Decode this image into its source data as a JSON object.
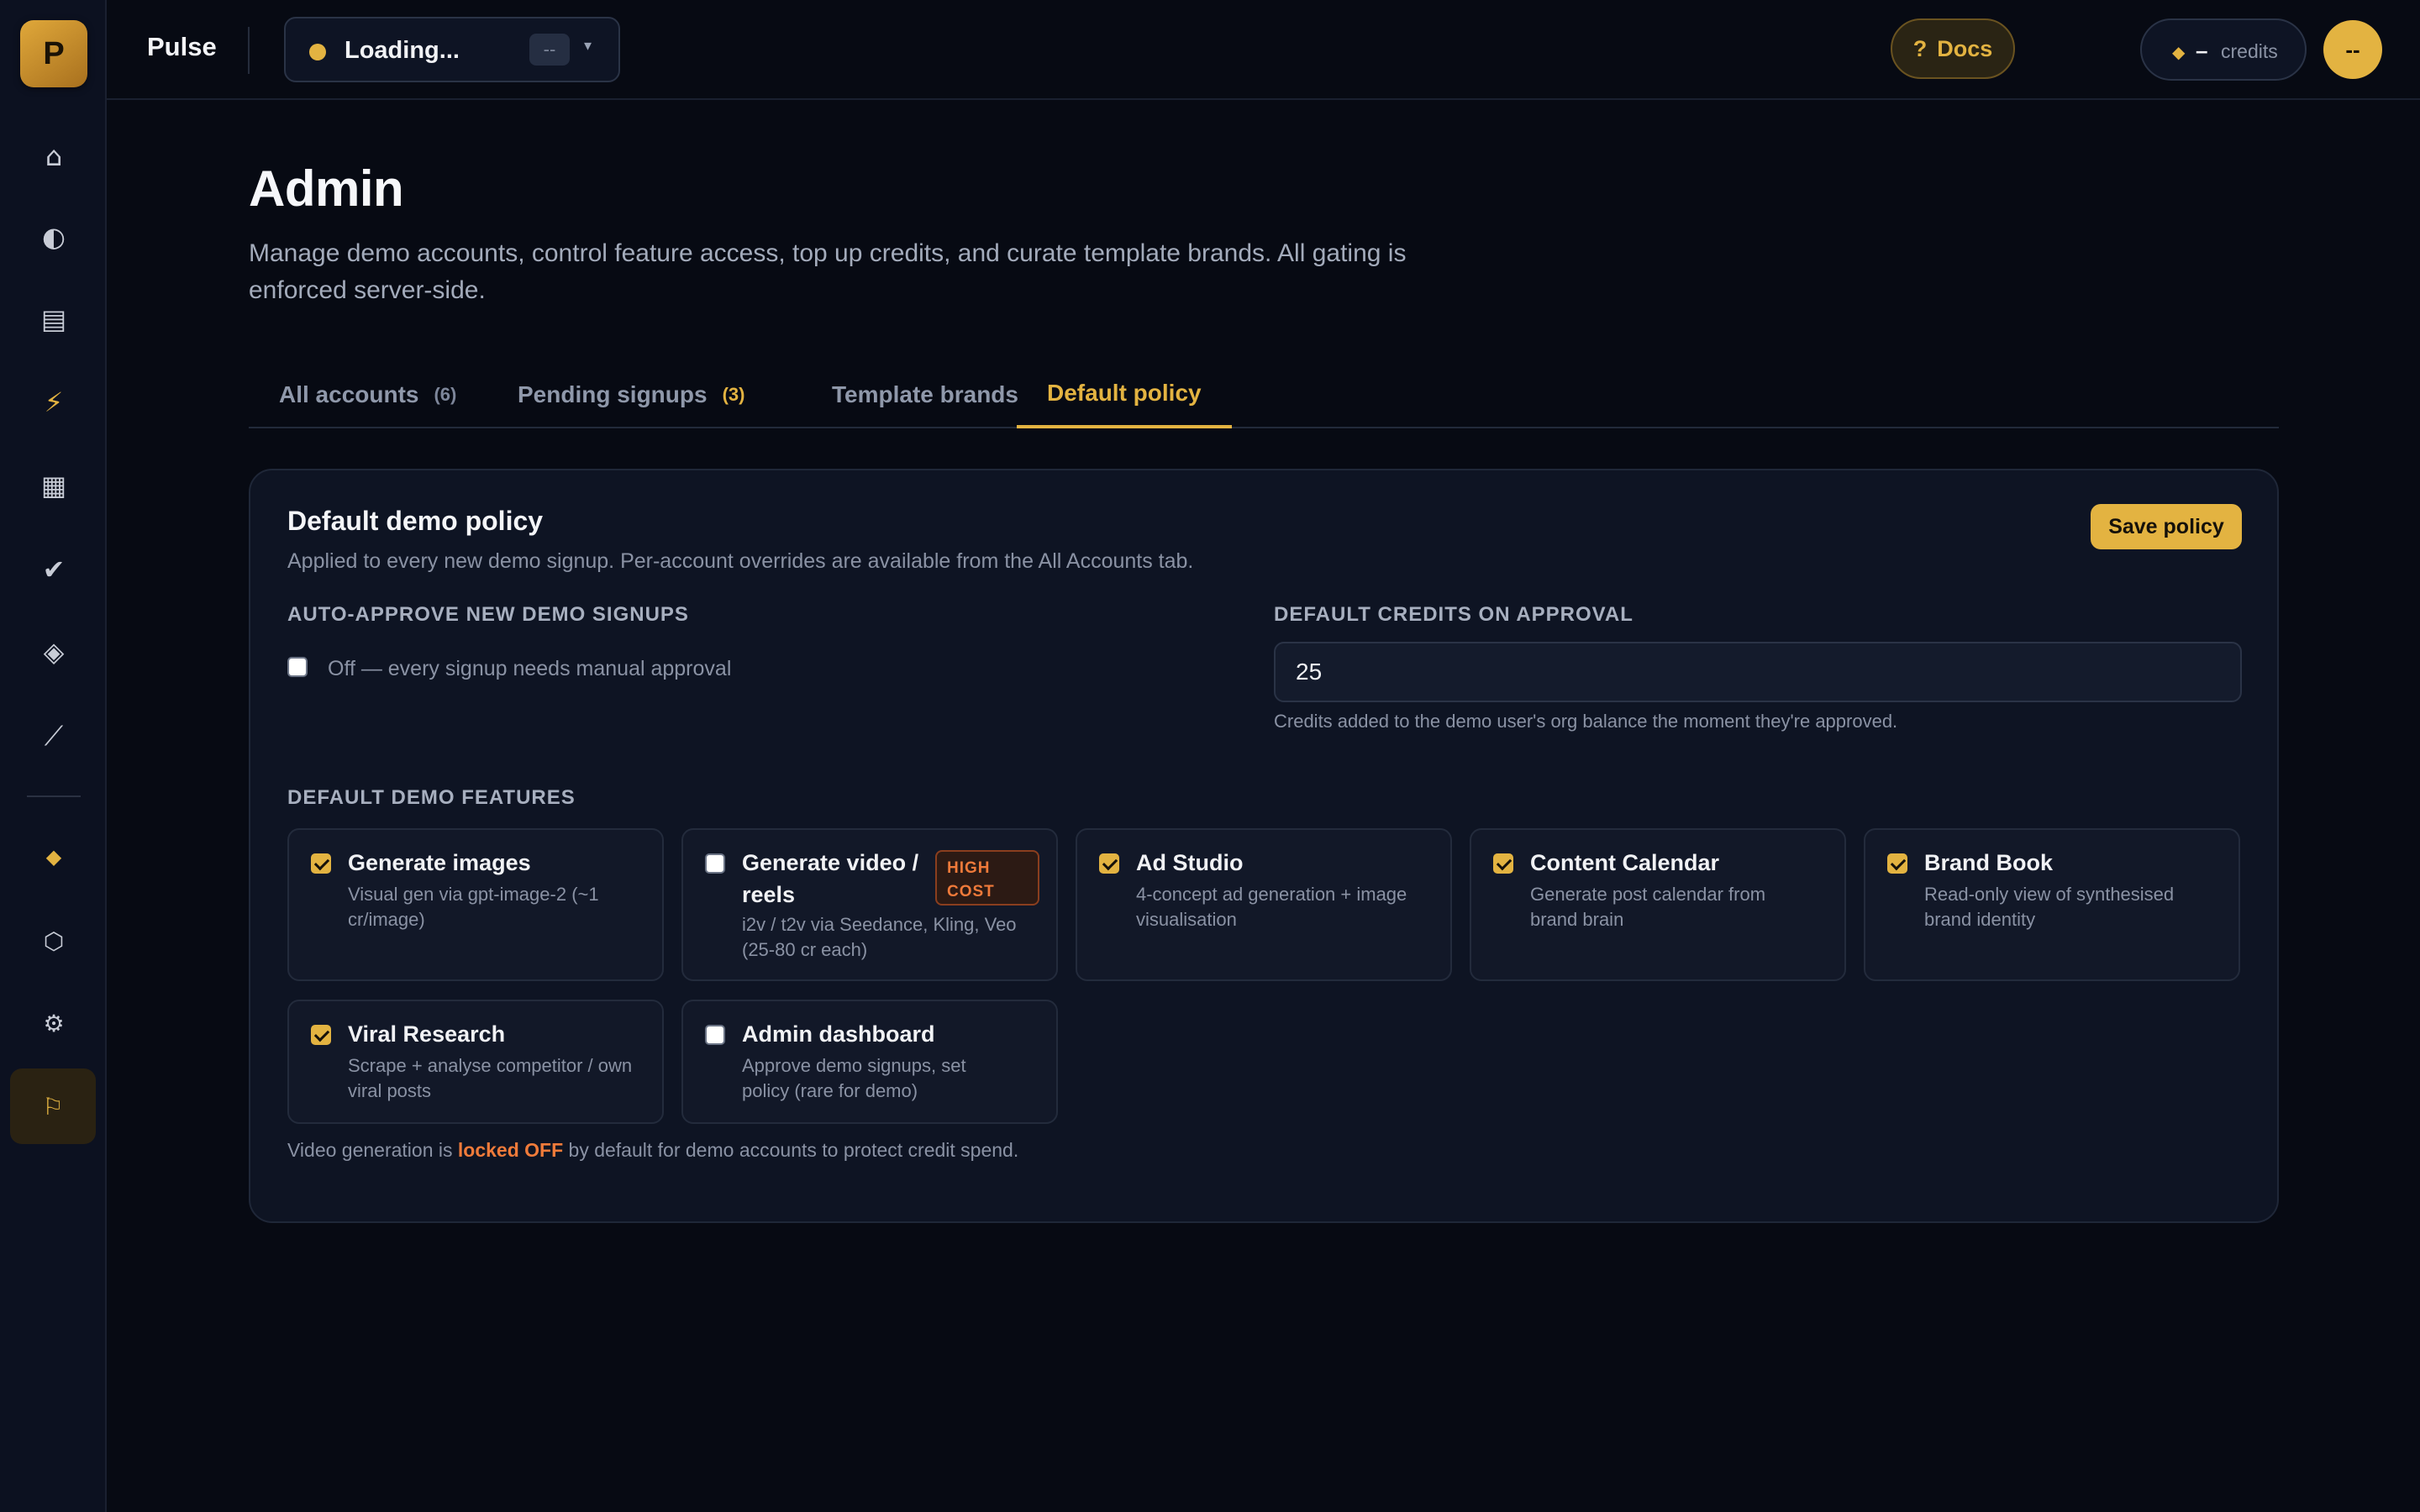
{
  "app": {
    "logo_letter": "P",
    "name": "Pulse"
  },
  "workspace": {
    "status": "Loading...",
    "badge": "--",
    "caret": "▾"
  },
  "topbar": {
    "docs_icon": "?",
    "docs_label": "Docs",
    "credits_icon": "◆",
    "credits_value": "–",
    "credits_label": "credits",
    "avatar": "--"
  },
  "sidebar": {
    "icons": [
      {
        "name": "home-icon",
        "glyph": "⌂"
      },
      {
        "name": "brand-brain-icon",
        "glyph": "◐"
      },
      {
        "name": "documents-icon",
        "glyph": "▤"
      },
      {
        "name": "lightning-icon",
        "glyph": "⚡"
      },
      {
        "name": "calendar-icon",
        "glyph": "▦"
      },
      {
        "name": "check-icon",
        "glyph": "✔"
      },
      {
        "name": "layers-icon",
        "glyph": "◈"
      },
      {
        "name": "trend-icon",
        "glyph": "⟋"
      },
      {
        "name": "diamond-icon",
        "glyph": "◆"
      },
      {
        "name": "hexagon-icon",
        "glyph": "⬡"
      },
      {
        "name": "settings-icon",
        "glyph": "⚙"
      },
      {
        "name": "admin-flag-icon",
        "glyph": "⚐"
      }
    ]
  },
  "page": {
    "title": "Admin",
    "description": "Manage demo accounts, control feature access, top up credits, and curate template brands. All gating is enforced server-side."
  },
  "tabs": [
    {
      "label": "All accounts",
      "count": "(6)"
    },
    {
      "label": "Pending signups",
      "count": "(3)"
    },
    {
      "label": "Template brands",
      "count": ""
    },
    {
      "label": "Default policy",
      "count": ""
    }
  ],
  "policy": {
    "title": "Default demo policy",
    "subtitle": "Applied to every new demo signup. Per-account overrides are available from the All Accounts tab.",
    "save_label": "Save policy",
    "auto_approve_label": "Auto-approve new demo signups",
    "auto_approve_text": "Off — every signup needs manual approval",
    "auto_approve_checked": false,
    "credits_label": "Default credits on approval",
    "credits_value": "25",
    "credits_help": "Credits added to the demo user's org balance the moment they're approved.",
    "features_label": "Default demo features",
    "features": [
      {
        "title": "Generate images",
        "desc": "Visual gen via gpt-image-2 (~1 cr/image)",
        "checked": true
      },
      {
        "title": "Generate video / reels",
        "desc": "i2v / t2v via Seedance, Kling, Veo (25-80 cr each)",
        "checked": false,
        "badge": "HIGH COST"
      },
      {
        "title": "Ad Studio",
        "desc": "4-concept ad generation + image visualisation",
        "checked": true
      },
      {
        "title": "Content Calendar",
        "desc": "Generate post calendar from brand brain",
        "checked": true
      },
      {
        "title": "Brand Book",
        "desc": "Read-only view of synthesised brand identity",
        "checked": true
      },
      {
        "title": "Viral Research",
        "desc": "Scrape + analyse competitor / own viral posts",
        "checked": true
      },
      {
        "title": "Admin dashboard",
        "desc": "Approve demo signups, set policy (rare for demo)",
        "checked": false
      }
    ],
    "footnote_pre": "Video generation is",
    "footnote_warn": "locked OFF",
    "footnote_post": "by default for demo accounts to protect credit spend."
  },
  "colors": {
    "accent": "#e3b341",
    "warning": "#f07b3a",
    "background": "#070a13"
  }
}
